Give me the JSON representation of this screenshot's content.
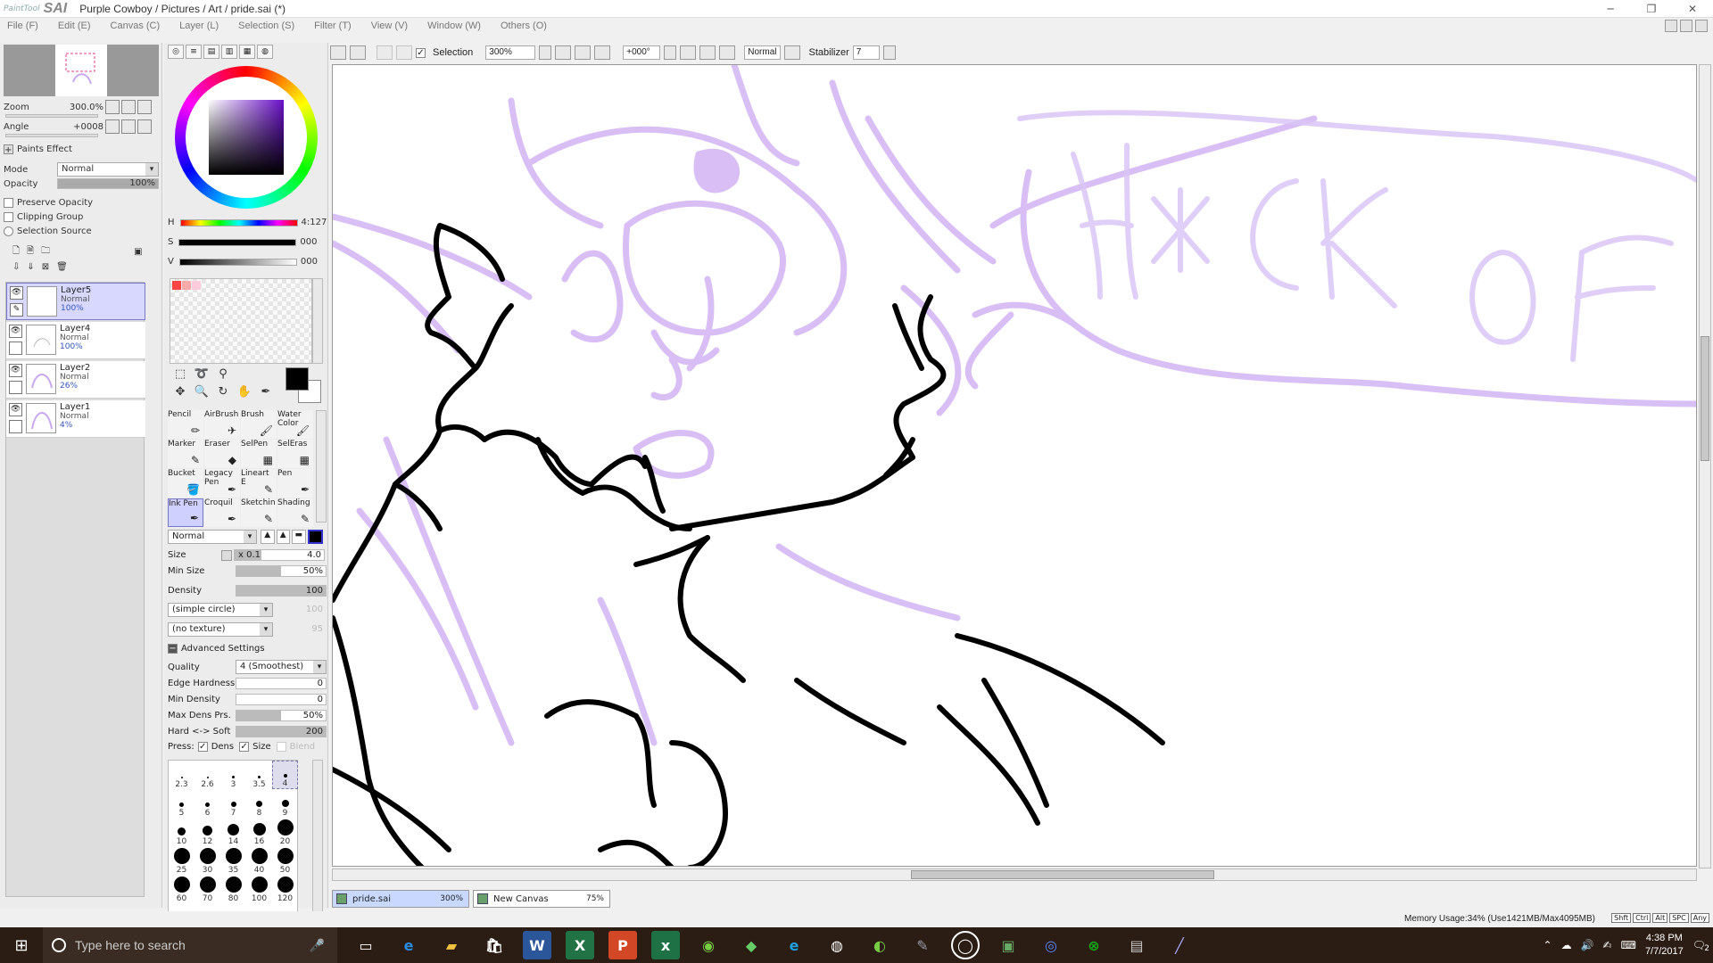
{
  "window": {
    "logo_small": "PaintTool",
    "logo_big": "SAI",
    "title": "Purple Cowboy / Pictures / Art / pride.sai (*)"
  },
  "menu": [
    "File (F)",
    "Edit (E)",
    "Canvas (C)",
    "Layer (L)",
    "Selection (S)",
    "Filter (T)",
    "View (V)",
    "Window (W)",
    "Others (O)"
  ],
  "navigator": {
    "zoom_label": "Zoom",
    "zoom_value": "300.0%",
    "angle_label": "Angle",
    "angle_value": "+0008"
  },
  "layer_props": {
    "paints_effect": "Paints Effect",
    "mode_label": "Mode",
    "mode_value": "Normal",
    "opacity_label": "Opacity",
    "opacity_value": "100%",
    "preserve_opacity": "Preserve Opacity",
    "clipping_group": "Clipping Group",
    "selection_source": "Selection Source"
  },
  "layers": [
    {
      "name": "Layer5",
      "mode": "Normal",
      "opacity": "100%",
      "selected": true
    },
    {
      "name": "Layer4",
      "mode": "Normal",
      "opacity": "100%",
      "selected": false
    },
    {
      "name": "Layer2",
      "mode": "Normal",
      "opacity": "26%",
      "selected": false
    },
    {
      "name": "Layer1",
      "mode": "Normal",
      "opacity": "4%",
      "selected": false
    }
  ],
  "color": {
    "h_label": "H",
    "h_value": "4:127",
    "s_label": "S",
    "s_value": "000",
    "v_label": "V",
    "v_value": "000",
    "foreground": "#000000",
    "background": "#ffffff",
    "swatch_colors": [
      "#ff4444",
      "#ffaaaa",
      "#ffccdd"
    ]
  },
  "brushes": [
    [
      "Pencil",
      "AirBrush",
      "Brush",
      "Water Color"
    ],
    [
      "Marker",
      "Eraser",
      "SelPen",
      "SelEras"
    ],
    [
      "Bucket",
      "Legacy Pen",
      "Lineart E",
      "Pen"
    ],
    [
      "Ink Pen",
      "Croquil",
      "Sketchin",
      "Shading"
    ]
  ],
  "selected_brush": "Ink Pen",
  "brush_settings": {
    "blend_mode": "Normal",
    "size_label": "Size",
    "size_mult": "x 0.1",
    "size_value": "4.0",
    "min_size_label": "Min Size",
    "min_size_value": "50%",
    "density_label": "Density",
    "density_value": "100",
    "shape": "(simple circle)",
    "shape_value": "100",
    "texture": "(no texture)",
    "texture_value": "95",
    "advanced": "Advanced Settings",
    "quality_label": "Quality",
    "quality_value": "4 (Smoothest)",
    "edge_label": "Edge Hardness",
    "edge_value": "0",
    "min_density_label": "Min Density",
    "min_density_value": "0",
    "max_dens_label": "Max Dens Prs.",
    "max_dens_value": "50%",
    "hard_soft_label": "Hard <-> Soft",
    "hard_soft_value": "200",
    "press_label": "Press:",
    "press_dens": "Dens",
    "press_size": "Size",
    "press_blend": "Blend"
  },
  "brush_sizes": [
    "2.3",
    "2.6",
    "3",
    "3.5",
    "4",
    "5",
    "6",
    "7",
    "8",
    "9",
    "10",
    "12",
    "14",
    "16",
    "20",
    "25",
    "30",
    "35",
    "40",
    "50",
    "60",
    "70",
    "80",
    "100",
    "120"
  ],
  "selected_size": "4",
  "toolbar": {
    "selection_label": "Selection",
    "zoom_value": "300%",
    "rotation_value": "+000°",
    "mode_value": "Normal",
    "stabilizer_label": "Stabilizer",
    "stabilizer_value": "7"
  },
  "canvas_text": "H*CK OF",
  "doc_tabs": [
    {
      "name": "pride.sai",
      "zoom": "300%",
      "active": true
    },
    {
      "name": "New Canvas",
      "zoom": "75%",
      "active": false
    }
  ],
  "status": {
    "memory": "Memory Usage:34% (Use1421MB/Max4095MB)",
    "keys": [
      "Shft",
      "Ctrl",
      "Alt",
      "SPC",
      "Any"
    ]
  },
  "taskbar": {
    "search_placeholder": "Type here to search",
    "time": "4:38 PM",
    "date": "7/7/2017",
    "notif_count": "2"
  }
}
